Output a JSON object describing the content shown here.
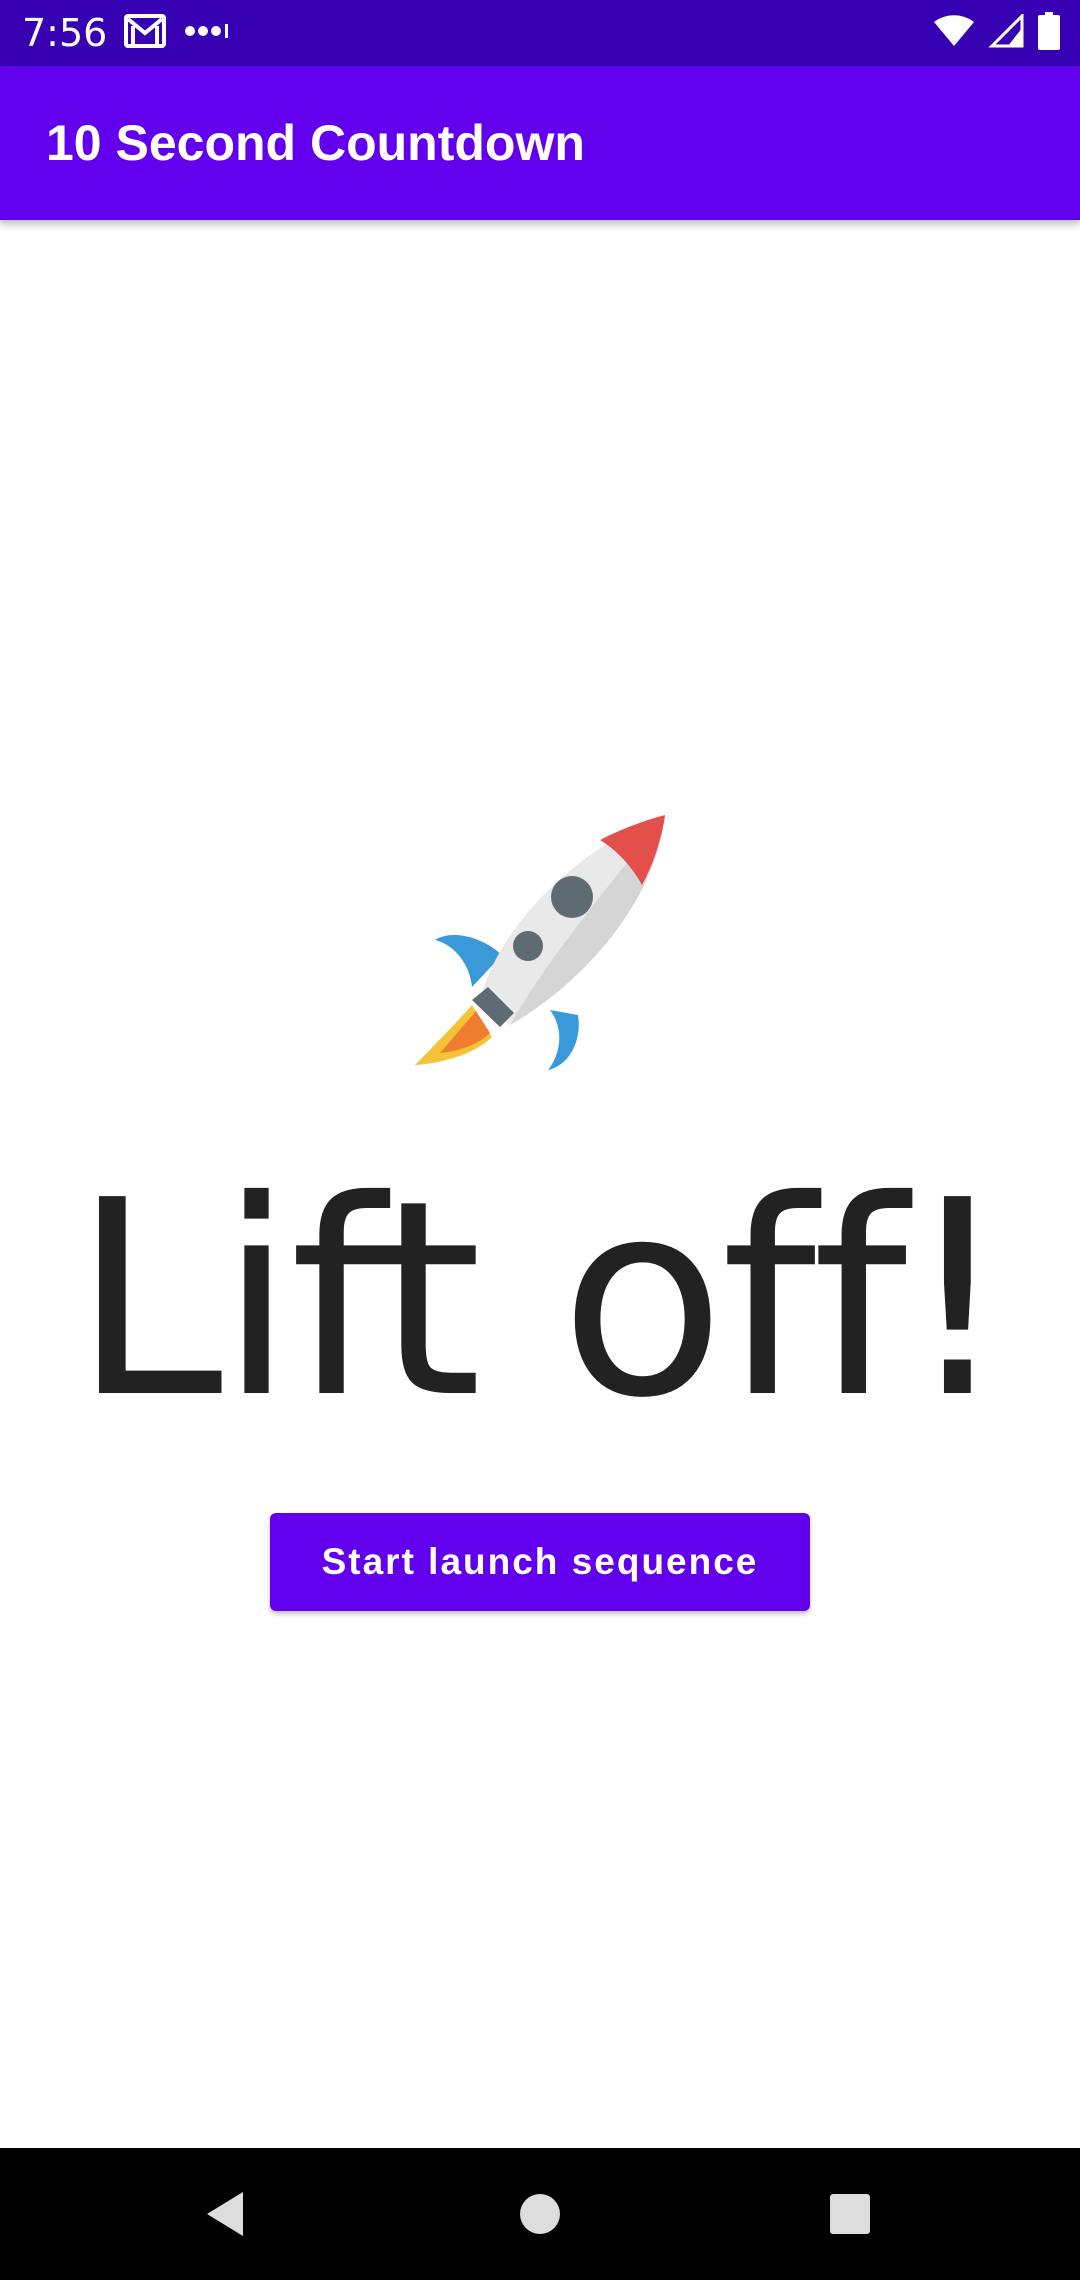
{
  "status_bar": {
    "time": "7:56",
    "icons": [
      "gmail-icon",
      "more-dots-icon",
      "wifi-icon",
      "signal-icon",
      "battery-icon"
    ]
  },
  "app_bar": {
    "title": "10 Second Countdown"
  },
  "main": {
    "image_icon": "rocket-icon",
    "status_text": "Lift off!",
    "button_label": "Start launch sequence"
  },
  "nav_bar": {
    "icons": [
      "back-icon",
      "home-icon",
      "recents-icon"
    ]
  },
  "colors": {
    "status_bar": "#3700b3",
    "primary": "#6200ee",
    "text": "#222222",
    "nav_bar": "#000000"
  }
}
